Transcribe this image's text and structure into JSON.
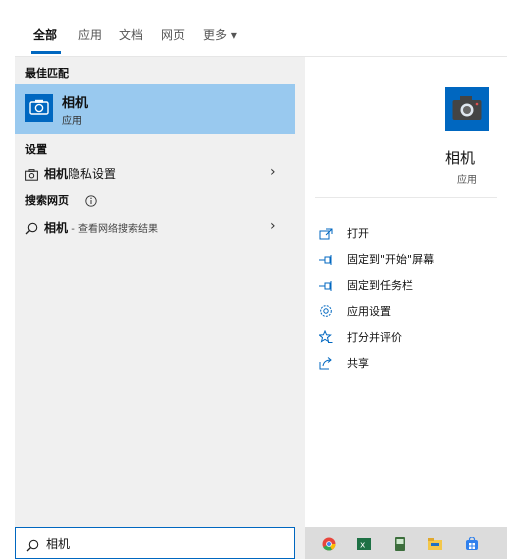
{
  "tabs": [
    {
      "label": "全部",
      "active": true
    },
    {
      "label": "应用"
    },
    {
      "label": "文档"
    },
    {
      "label": "网页"
    },
    {
      "label": "更多 ▾"
    }
  ],
  "best_match": {
    "section": "最佳匹配",
    "name": "相机",
    "type": "应用"
  },
  "settings": {
    "section": "设置",
    "item_bold": "相机",
    "item_rest": "隐私设置"
  },
  "web": {
    "section": "搜索网页",
    "info_icon": "info-icon",
    "item_bold": "相机",
    "item_rest": " - 查看网络搜索结果"
  },
  "detail": {
    "name": "相机",
    "type": "应用",
    "actions": [
      {
        "label": "打开",
        "icon": "open-icon"
      },
      {
        "label": "固定到\"开始\"屏幕",
        "icon": "pin-start-icon"
      },
      {
        "label": "固定到任务栏",
        "icon": "pin-taskbar-icon"
      },
      {
        "label": "应用设置",
        "icon": "gear-icon"
      },
      {
        "label": "打分并评价",
        "icon": "rate-icon"
      },
      {
        "label": "共享",
        "icon": "share-icon"
      }
    ]
  },
  "search": {
    "value": "相机"
  },
  "taskbar_icons": [
    "chrome-icon",
    "excel-icon",
    "app-icon",
    "file-explorer-icon",
    "store-icon"
  ],
  "colors": {
    "accent": "#0067c0",
    "selection": "#99c9ef"
  }
}
